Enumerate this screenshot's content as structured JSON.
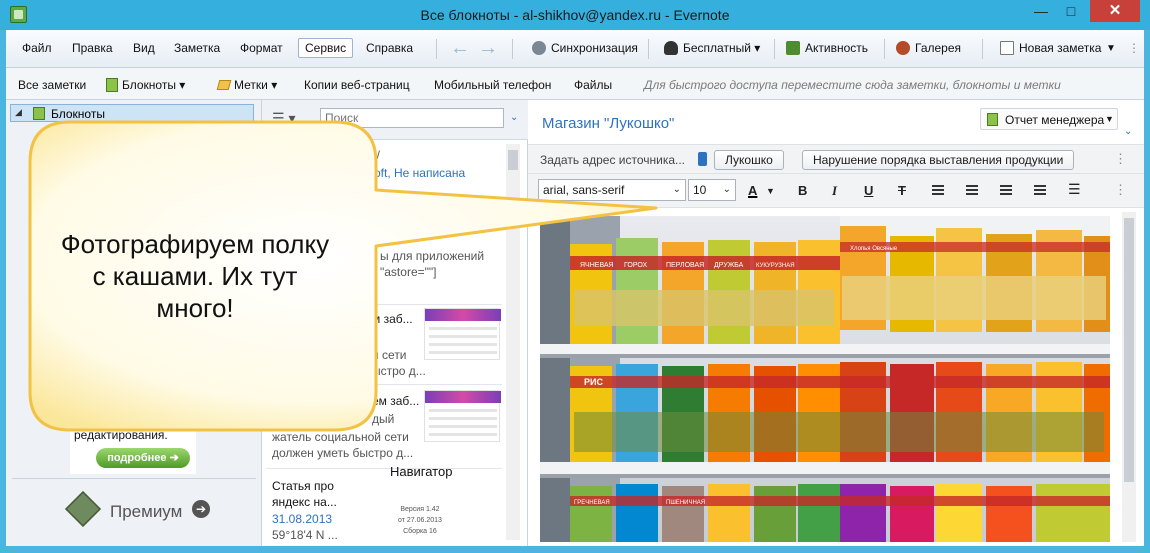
{
  "window": {
    "title": "Все блокноты - al-shikhov@yandex.ru - Evernote",
    "minimize": "—",
    "maximize": "□",
    "close": "✕"
  },
  "menu": {
    "items": [
      "Файл",
      "Правка",
      "Вид",
      "Заметка",
      "Формат",
      "Сервис",
      "Справка"
    ]
  },
  "toolbar": {
    "back": "←",
    "forward": "→",
    "sync": "Синхронизация",
    "account": "Бесплатный",
    "activity": "Активность",
    "gallery": "Галерея",
    "new_note": "Новая заметка",
    "more": "⋮"
  },
  "shortcuts": {
    "all_notes": "Все заметки",
    "notebooks": "Блокноты",
    "tags": "Метки",
    "web_clips": "Копии веб-страниц",
    "mobile": "Мобильный телефон",
    "files": "Файлы",
    "hint": "Для быстрого доступа переместите сюда заметки, блокноты и метки"
  },
  "sidebar": {
    "expander": "◢",
    "notebooks_label": "Блокноты",
    "ad_text": "редактирования.",
    "ad_button": "подробнее",
    "premium_label": "Премиум",
    "premium_arrow": "➔"
  },
  "notelist": {
    "view_icon": "☰ ▾",
    "search_placeholder": "Поиск",
    "search_icon": "⌕",
    "collapse": "⌄",
    "fragments": [
      "n/",
      "oft, Не написана",
      "ы для приложений",
      "\"astore=\"\"]",
      "м заб...",
      "й сети",
      "ыстро д...",
      "ем заб...",
      "дый",
      "жатель социальной сети",
      "должен уметь быстро д..."
    ],
    "last_note": {
      "title_line1": "Статья про",
      "title_line2": "яндекс на...",
      "date": "31.08.2013",
      "coords": "59°18'4 N ...",
      "thumb_title": "Навигатор",
      "thumb_meta_line1": "Версия 1.42",
      "thumb_meta_line2": "от 27.06.2013",
      "thumb_meta_line3": "Сборка 16"
    }
  },
  "editor": {
    "title": "Магазин \"Лукошко\"",
    "notebook": "Отчет менеджера",
    "collapse": "⌄",
    "source_prompt": "Задать адрес источника...",
    "tags": [
      "Лукошко",
      "Нарушение порядка выставления продукции"
    ],
    "more": "⋮",
    "font_family": "arial, sans-serif",
    "font_size": "10",
    "format_buttons": {
      "font_color": "A",
      "bold": "B",
      "italic": "I",
      "underline": "U",
      "strikethrough": "T"
    },
    "photo_labels": {
      "cereal_name_1": "ЯЧНЕВАЯ",
      "cereal_name_2": "ГОРОХ",
      "cereal_name_3": "ПЕРЛОВАЯ",
      "cereal_name_4": "ДРУЖБА",
      "cereal_name_5": "КУКУРУЗНАЯ",
      "cereal_name_6": "РИС",
      "cereal_name_7": "ГРЕЧНЕВАЯ",
      "cereal_name_8": "ПШЕНИЧНАЯ",
      "flakes": "Хлопья Овсяные"
    }
  },
  "callout": {
    "text_line1": "Фотографируем полку",
    "text_line2": "с кашами. Их тут",
    "text_line3": "много!"
  },
  "colors": {
    "window_frame": "#35b0de",
    "accent_blue": "#2e73c0",
    "callout_fill": "#fffbe6",
    "callout_border": "#f3c243"
  }
}
